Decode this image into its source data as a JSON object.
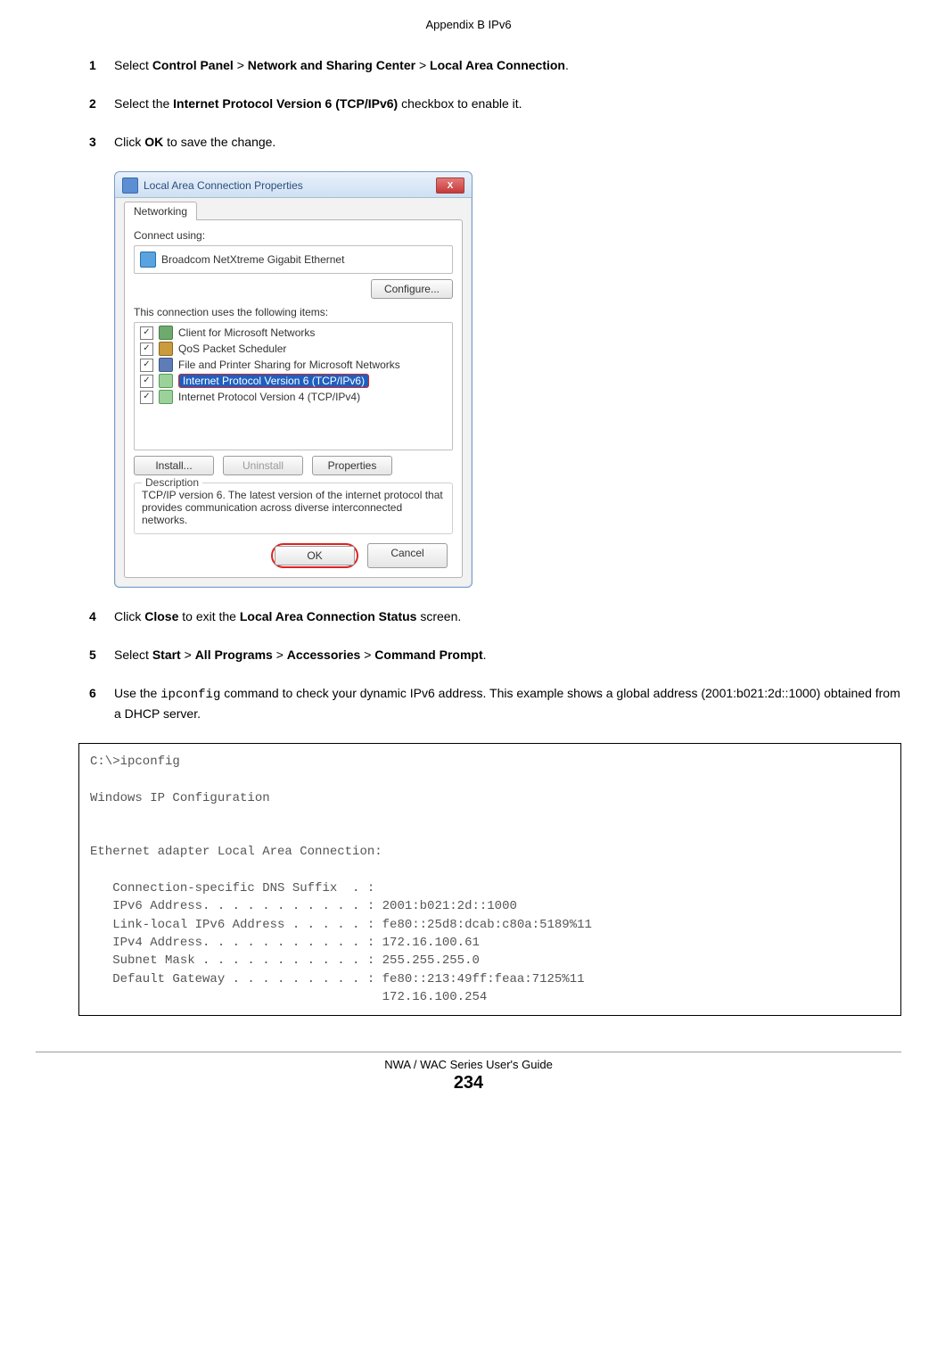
{
  "header": {
    "top": "Appendix B IPv6"
  },
  "steps": {
    "s1": {
      "num": "1",
      "pre": "Select ",
      "b1": "Control Panel",
      "sep1": " > ",
      "b2": "Network and Sharing Center",
      "sep2": " > ",
      "b3": "Local Area Connection",
      "post": "."
    },
    "s2": {
      "num": "2",
      "pre": "Select the ",
      "b1": "Internet Protocol Version 6 (TCP/IPv6)",
      "post": " checkbox to enable it."
    },
    "s3": {
      "num": "3",
      "pre": "Click ",
      "b1": "OK",
      "post": " to save the change."
    },
    "s4": {
      "num": "4",
      "pre": "Click ",
      "b1": "Close",
      "mid": " to exit the ",
      "b2": "Local Area Connection Status",
      "post": " screen."
    },
    "s5": {
      "num": "5",
      "pre": "Select ",
      "b1": "Start",
      "sep1": " > ",
      "b2": "All Programs",
      "sep2": " > ",
      "b3": "Accessories",
      "sep3": " > ",
      "b4": "Command Prompt",
      "post": "."
    },
    "s6": {
      "num": "6",
      "pre": "Use the ",
      "code": "ipconfig",
      "post": " command to check your dynamic IPv6 address. This example shows a global address (2001:b021:2d::1000) obtained from a DHCP server."
    }
  },
  "dialog": {
    "title": "Local Area Connection Properties",
    "close_x": "X",
    "tab": "Networking",
    "connect_label": "Connect using:",
    "adapter": "Broadcom NetXtreme Gigabit Ethernet",
    "configure": "Configure...",
    "items_label": "This connection uses the following items:",
    "items": [
      {
        "checked": "✓",
        "label": "Client for Microsoft Networks"
      },
      {
        "checked": "✓",
        "label": "QoS Packet Scheduler"
      },
      {
        "checked": "✓",
        "label": "File and Printer Sharing for Microsoft Networks"
      },
      {
        "checked": "✓",
        "label": "Internet Protocol Version 6 (TCP/IPv6)"
      },
      {
        "checked": "✓",
        "label": "Internet Protocol Version 4 (TCP/IPv4)"
      }
    ],
    "install": "Install...",
    "uninstall": "Uninstall",
    "properties": "Properties",
    "desc_legend": "Description",
    "desc_text": "TCP/IP version 6. The latest version of the internet protocol that provides communication across diverse interconnected networks.",
    "ok": "OK",
    "cancel": "Cancel"
  },
  "code": "C:\\>ipconfig\n\nWindows IP Configuration\n\n\nEthernet adapter Local Area Connection:\n\n   Connection-specific DNS Suffix  . : \n   IPv6 Address. . . . . . . . . . . : 2001:b021:2d::1000\n   Link-local IPv6 Address . . . . . : fe80::25d8:dcab:c80a:5189%11\n   IPv4 Address. . . . . . . . . . . : 172.16.100.61\n   Subnet Mask . . . . . . . . . . . : 255.255.255.0\n   Default Gateway . . . . . . . . . : fe80::213:49ff:feaa:7125%11\n                                       172.16.100.254",
  "footer": {
    "guide": "NWA / WAC Series User's Guide",
    "page": "234"
  }
}
